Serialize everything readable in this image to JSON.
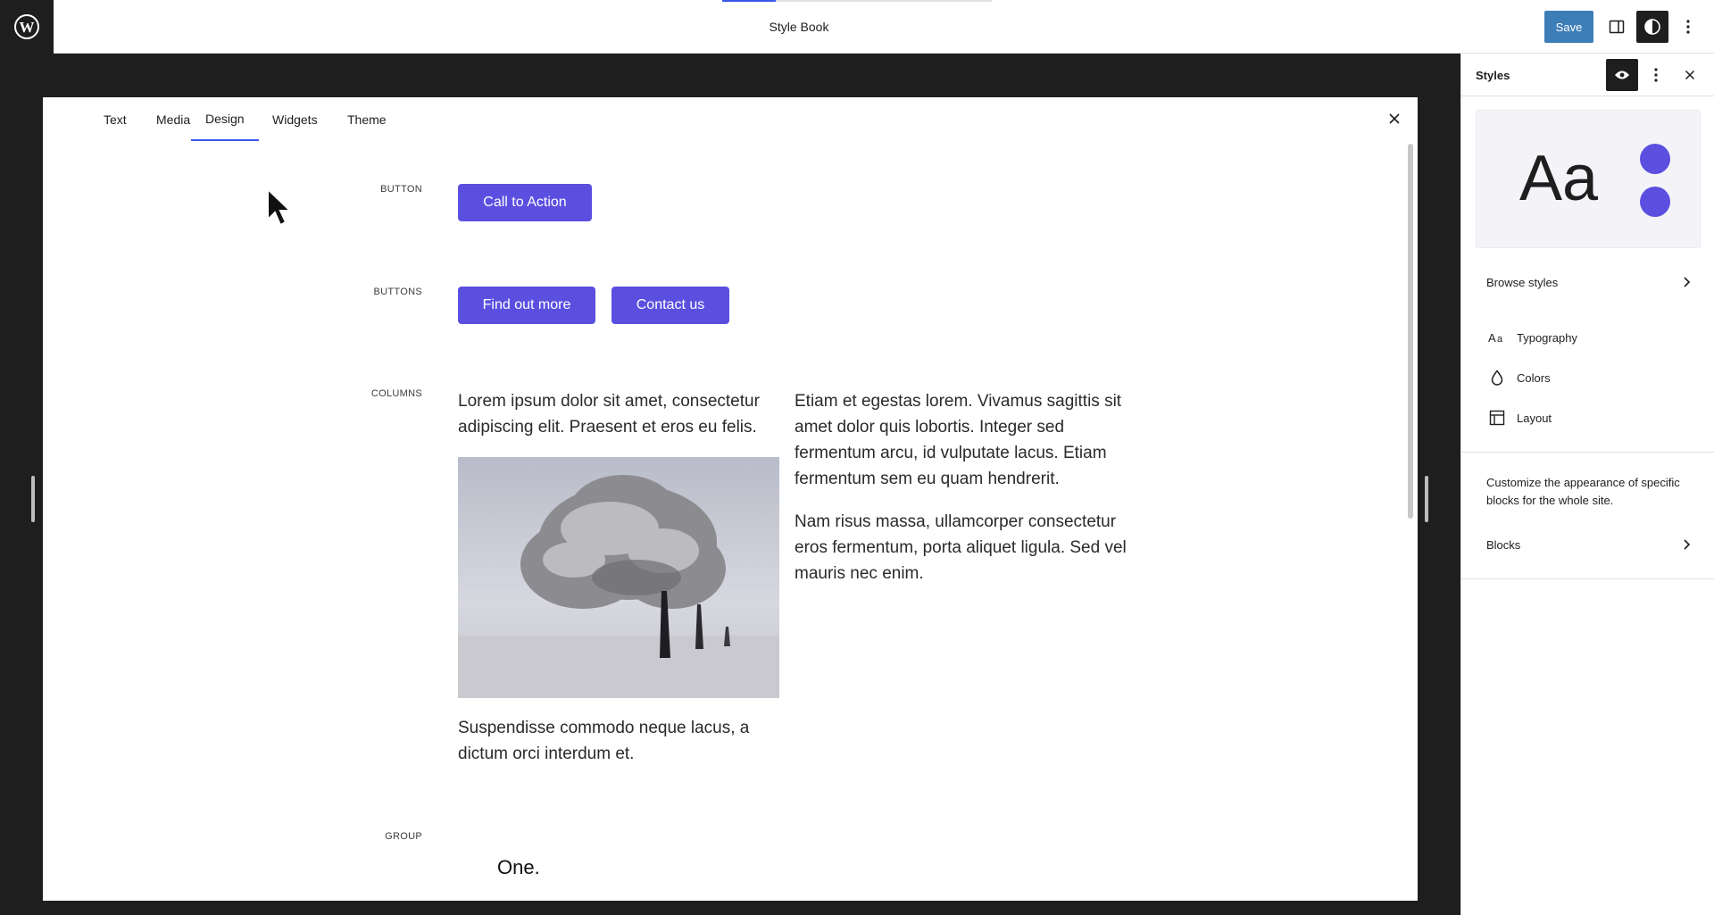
{
  "topbar": {
    "title": "Style Book",
    "save_label": "Save",
    "progress": 0.2
  },
  "tabs": [
    {
      "label": "Text"
    },
    {
      "label": "Media"
    },
    {
      "label": "Design"
    },
    {
      "label": "Widgets"
    },
    {
      "label": "Theme"
    }
  ],
  "active_tab": "Design",
  "sections": {
    "button": {
      "label": "BUTTON",
      "buttons": [
        "Call to Action"
      ]
    },
    "buttons": {
      "label": "BUTTONS",
      "buttons": [
        "Find out more",
        "Contact us"
      ]
    },
    "columns": {
      "label": "COLUMNS",
      "col1_para1": "Lorem ipsum dolor sit amet, consectetur adipiscing elit. Praesent et eros eu felis.",
      "col1_para2": "Suspendisse commodo neque lacus, a dictum orci interdum et.",
      "col2_para1": "Etiam et egestas lorem. Vivamus sagittis sit amet dolor quis lobortis. Integer sed fermentum arcu, id vulputate lacus. Etiam fermentum sem eu quam hendrerit.",
      "col2_para2": "Nam risus massa, ullamcorper consectetur eros fermentum, porta aliquet ligula. Sed vel mauris nec enim."
    },
    "group": {
      "label": "GROUP",
      "text": "One."
    }
  },
  "sidebar": {
    "title": "Styles",
    "preview_text": "Aa",
    "browse_styles": "Browse styles",
    "items": [
      {
        "label": "Typography",
        "icon": "typography-icon"
      },
      {
        "label": "Colors",
        "icon": "droplet-icon"
      },
      {
        "label": "Layout",
        "icon": "layout-icon"
      }
    ],
    "description": "Customize the appearance of specific blocks for the whole site.",
    "blocks": "Blocks"
  },
  "colors": {
    "accent": "#5b4fe0",
    "save": "#3e7eb8",
    "admin_blue": "#3858e9"
  }
}
